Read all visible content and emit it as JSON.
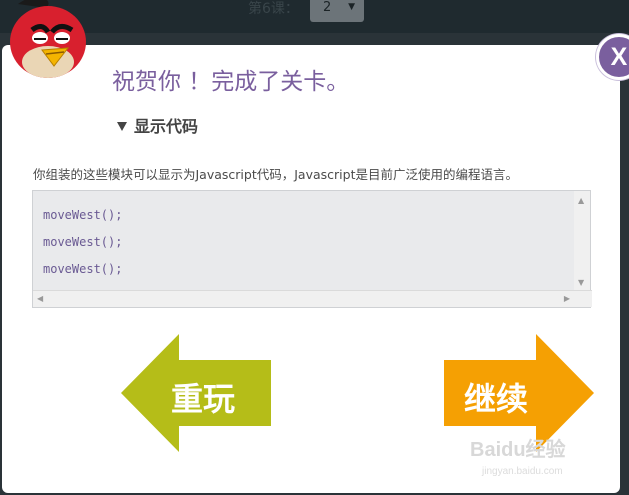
{
  "topbar": {
    "lesson_label": "第6课：",
    "lesson_select_value": "2"
  },
  "dialog": {
    "title": "祝贺你 ！完成了关卡。",
    "show_code_toggle": "显示代码",
    "description": "你组装的这些模块可以显示为Javascript代码，Javascript是目前广泛使用的编程语言。",
    "code_lines": [
      "moveWest();",
      "moveWest();",
      "moveWest();"
    ],
    "close_label": "X",
    "replay_label": "重玩",
    "continue_label": "继续"
  },
  "watermark": {
    "text": "Baidu经验",
    "sub": "jingyan.baidu.com"
  },
  "colors": {
    "title_purple": "#7a5f9e",
    "replay_green": "#b5bd18",
    "continue_orange": "#f5a003",
    "bird_red": "#d8202e"
  }
}
